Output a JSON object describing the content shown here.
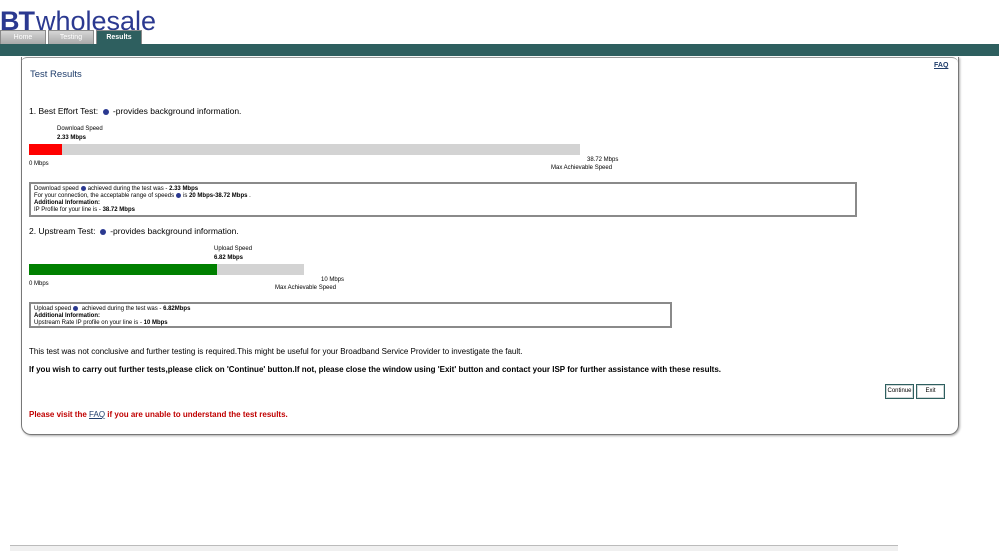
{
  "brand": {
    "bt": "BT",
    "wholesale": "wholesale"
  },
  "tabs": [
    {
      "label": "Home",
      "active": false
    },
    {
      "label": "Testing",
      "active": false
    },
    {
      "label": "Results",
      "active": true
    }
  ],
  "faq_link": "FAQ",
  "title": "Test Results",
  "best_effort": {
    "heading": "1. Best Effort Test:",
    "heading_suffix": "-provides background information.",
    "bar_label": "Download Speed",
    "bar_value": "2.33 Mbps",
    "min_label": "0 Mbps",
    "max_value": "38.72 Mbps",
    "max_label": "Max Achievable Speed",
    "fraction": 0.0602,
    "fill_color": "#ff0000",
    "box_lines": [
      {
        "pre": "Download speed",
        "icon": true,
        "mid": "achieved during the test was - ",
        "strong": "2.33 Mbps",
        "post": ""
      },
      {
        "pre": "For your connection, the acceptable range of speeds",
        "icon": true,
        "mid": "is ",
        "strong": "20 Mbps-38.72 Mbps",
        "post": " ."
      },
      {
        "pre": "",
        "icon": false,
        "mid": "",
        "strong": "Additional Information:",
        "post": ""
      },
      {
        "pre": "IP Profile for your line is - ",
        "icon": false,
        "mid": "",
        "strong": "38.72 Mbps",
        "post": ""
      }
    ]
  },
  "upstream": {
    "heading": "2. Upstream Test:",
    "heading_suffix": "-provides background information.",
    "bar_label": "Upload Speed",
    "bar_value": "6.82 Mbps",
    "min_label": "0 Mbps",
    "max_value": "10 Mbps",
    "max_label": "Max Achievable Speed",
    "fraction": 0.682,
    "fill_color": "#008000",
    "box_lines": [
      {
        "pre": "Upload speed",
        "icon": true,
        "mid": " achieved during the test was - ",
        "strong": "6.82Mbps",
        "post": ""
      },
      {
        "pre": "",
        "icon": false,
        "mid": "",
        "strong": "Additional Information:",
        "post": ""
      },
      {
        "pre": "Upstream Rate IP profile on your line is - ",
        "icon": false,
        "mid": "",
        "strong": "10 Mbps",
        "post": ""
      }
    ]
  },
  "message_inconclusive": "This test was not conclusive and further testing is required.This might be useful for your Broadband Service Provider to investigate the fault.",
  "message_instructions": "If you wish to carry out further tests,please click on 'Continue' button.If not, please close the window using 'Exit' button and contact your ISP for further assistance with these results.",
  "buttons": {
    "continue": "Continue",
    "exit": "Exit"
  },
  "footer_note": {
    "pre": "Please visit the ",
    "link": "FAQ",
    "post": " if you are unable to understand the test results."
  },
  "colors": {
    "header_band": "#2e5f5f",
    "brand_blue": "#2b3990",
    "warning_red": "#c00000"
  }
}
